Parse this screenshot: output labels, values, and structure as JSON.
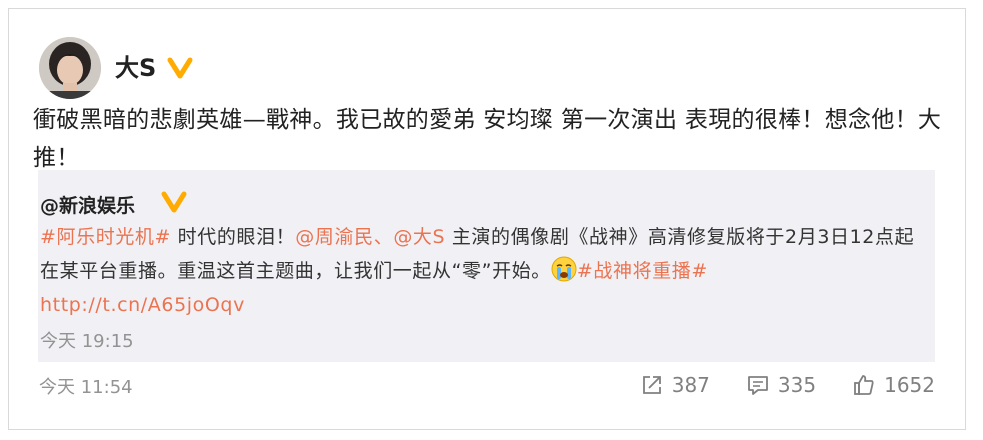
{
  "post": {
    "author": "大S",
    "verified_icon": "verified-badge-icon",
    "text": "衝破黑暗的悲劇英雄—戰神。我已故的愛弟 安均璨 第一次演出 表現的很棒！想念他！大推！",
    "time": "今天 11:54"
  },
  "repost": {
    "author": "@新浪娱乐",
    "topic1": "#阿乐时光机#",
    "text1": " 时代的眼泪！",
    "mention1": "@周渝民",
    "sep": "、",
    "mention2": "@大S",
    "text2": " 主演的偶像剧《战神》高清修复版将于2月3日12点起在某平台重播。重温这首主题曲，让我们一起从“零”开始。",
    "emoji": "crying-face-icon",
    "topic2": "#战神将重播#",
    "url": "http://t.cn/A65joOqv",
    "time": "今天 19:15"
  },
  "actions": {
    "repost_count": "387",
    "comment_count": "335",
    "like_count": "1652"
  },
  "colors": {
    "link": "#eb7350",
    "verified": "#ffab00",
    "muted": "#939393",
    "repost_bg": "#f1f1f5"
  }
}
